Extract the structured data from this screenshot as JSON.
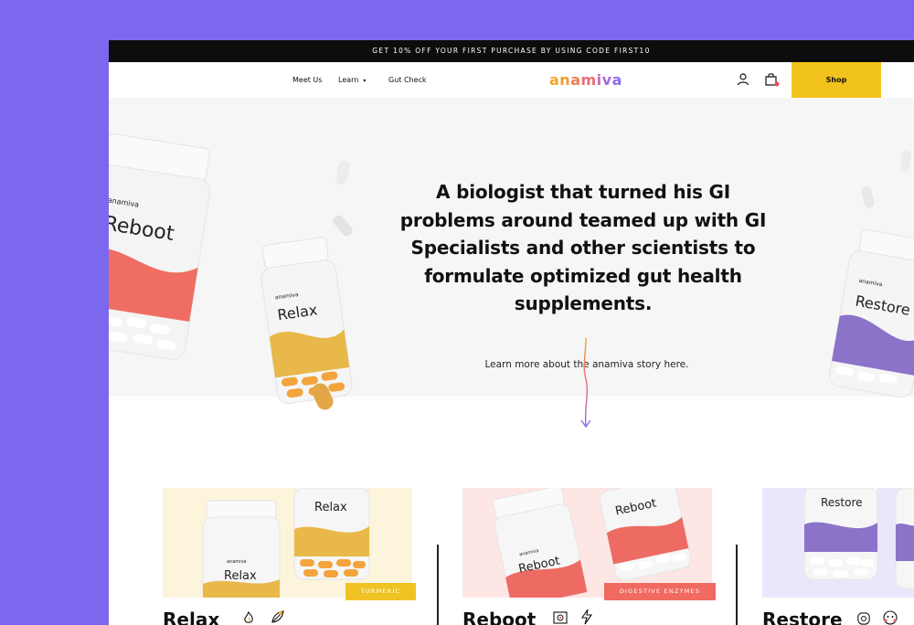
{
  "promo": {
    "text": "GET 10% OFF YOUR FIRST PURCHASE BY USING CODE FIRST10"
  },
  "nav": {
    "links": [
      {
        "label": "Meet Us"
      },
      {
        "label": "Learn",
        "caret": "▾"
      },
      {
        "label": "Gut Check"
      }
    ],
    "logo": [
      "a",
      "n",
      "a",
      "m",
      "i",
      "v",
      "a"
    ],
    "shop_label": "Shop",
    "icons": [
      "user-icon",
      "cart-icon"
    ]
  },
  "hero": {
    "heading": "A biologist that turned his GI problems around teamed up with GI Specialists and other scientists to formulate optimized gut health supplements.",
    "link": "Learn more about the anamiva story here."
  },
  "bottles": {
    "brand": "anamiva",
    "reboot": "Reboot",
    "relax": "Relax",
    "restore": "Restore"
  },
  "products": [
    {
      "name": "Relax",
      "tag": "TURMERIC",
      "tag_color": "#f0c325",
      "bg": "#fdf4dc",
      "accent": "#e8b94a",
      "icons": [
        "flame-icon",
        "leaf-icon"
      ]
    },
    {
      "name": "Reboot",
      "tag": "DIGESTIVE ENZYMES",
      "tag_color": "#f06a62",
      "bg": "#fde6e4",
      "accent": "#ee6b64",
      "icons": [
        "scan-icon",
        "bolt-icon"
      ]
    },
    {
      "name": "Restore",
      "tag": "",
      "tag_color": "#7a5fc0",
      "bg": "#ebe6fb",
      "accent": "#8a73c9",
      "icons": [
        "brain-icon",
        "face-icon"
      ]
    }
  ],
  "colors": {
    "background": "#7b68ee",
    "shop": "#f2c31c",
    "logo": [
      "#f2a62b",
      "#f29a2f",
      "#f27a54",
      "#ea6b78",
      "#c96ab8",
      "#a46bd8",
      "#8c6ce6"
    ]
  }
}
